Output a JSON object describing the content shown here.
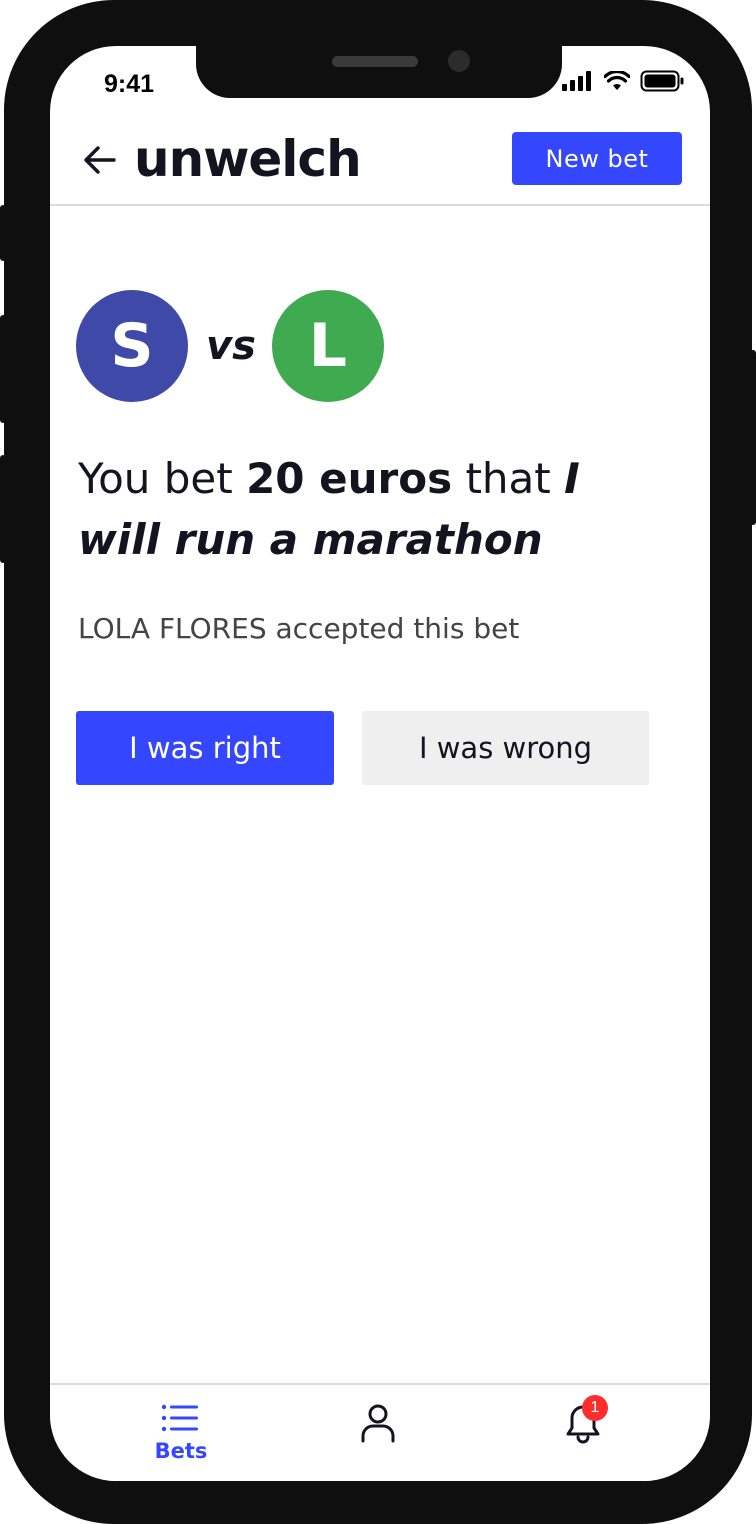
{
  "status_bar": {
    "time": "9:41"
  },
  "header": {
    "logo": "unwelch",
    "new_bet_label": "New bet"
  },
  "versus": {
    "player_one_initial": "S",
    "player_two_initial": "L",
    "vs_label": "vs",
    "player_one_color": "#3f4aa8",
    "player_two_color": "#3faa4f"
  },
  "bet": {
    "prefix": "You bet",
    "amount": "20 euros",
    "connector": "that",
    "claim": "I will run a marathon",
    "accepted_text": "LOLA FLORES accepted this bet"
  },
  "actions": {
    "right_label": "I was right",
    "wrong_label": "I was wrong"
  },
  "tabs": {
    "bets_label": "Bets",
    "notification_count": "1"
  },
  "colors": {
    "accent": "#3546ff",
    "badge": "#ff2d2d"
  }
}
